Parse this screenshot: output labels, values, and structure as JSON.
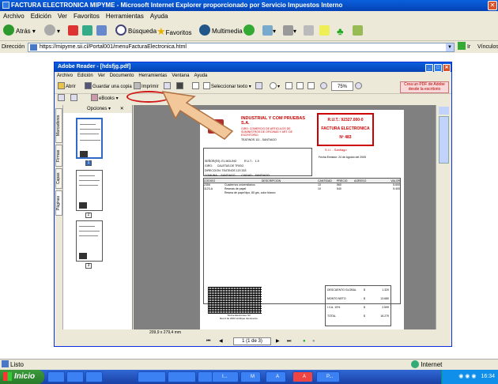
{
  "ie": {
    "title": "FACTURA ELECTRONICA MIPYME - Microsoft Internet Explorer proporcionado por Servicio Impuestos Interno",
    "menu": [
      "Archivo",
      "Edición",
      "Ver",
      "Favoritos",
      "Herramientas",
      "Ayuda"
    ],
    "toolbar": {
      "back": "Atrás",
      "search": "Búsqueda",
      "favorites": "Favoritos",
      "multimedia": "Multimedia"
    },
    "address_label": "Dirección",
    "address": "https://mipyme.sii.cl/Portal001/menuFacturaElectronica.html",
    "go": "Ir",
    "links": "Vínculos",
    "status": "Listo",
    "zone": "Internet"
  },
  "reader": {
    "title": "Adobe Reader - [hdsfjg.pdf]",
    "menu": [
      "Archivo",
      "Edición",
      "Ver",
      "Documento",
      "Herramientas",
      "Ventana",
      "Ayuda"
    ],
    "open": "Abrir",
    "save": "Guardar una copia",
    "print": "Imprimir",
    "select_text": "Seleccionar texto",
    "zoom": "75%",
    "ebooks": "eBooks",
    "pdf_banner": "Crea un PDF de Adobe desde la escritorio",
    "panel_title": "Opciones",
    "side_tabs": [
      "Marcadores",
      "Firmas",
      "Capas",
      "Páginas"
    ],
    "thumb_pages": [
      "1",
      "2",
      "3"
    ],
    "size": "209,9 x 279,4 mm",
    "page_field": "1 (1 de 3)"
  },
  "invoice": {
    "company": "INDUSTRIAL Y COM PRUEBAS S.A.",
    "activity": "GIRO: COMERCIO DE ARTICULOS DE SUMINISTROS DE OFICINAS Y ART. DE ESCRITORIO",
    "address": "TEATINOS 111 - SANTIAGO",
    "rut": "R.U.T.: 92327.000-0",
    "doc_type": "FACTURA ELECTRONICA",
    "number": "Nº 483",
    "sii": "S.I.I. - Santiago",
    "date": "Fecha Emisión: 24 de Agosto del 2005",
    "client": [
      "SEÑOR(ES): EL MOLINO          R.U.T.:   1-9",
      "GIRO:      CALETAS DE TRIGO",
      "DIRECCION: TEATINOS 120 333",
      "COMUNA:    SANTIAGO        CIUDAD:   SANTIAGO",
      "CONTACTO:  Juan Cerro"
    ],
    "headers": [
      "CODIGO",
      "DESCRIPCION",
      "CANTIDAD",
      "PRECIO",
      "AGREGO",
      "VALOR"
    ],
    "rows": [
      [
        "2356",
        "Cuadernos universitarios",
        "10",
        "560",
        "",
        "5.600"
      ],
      [
        "1123-A",
        "Resmas de papel",
        "10",
        "540",
        "",
        "5.400"
      ],
      [
        "",
        "Resma de papel tipo, 80 grs, color blanco",
        "",
        "",
        "",
        ""
      ]
    ],
    "totals": [
      [
        "DESCUENTO GLOBAL",
        "$",
        "1.320"
      ],
      [
        "MONTO NETO",
        "$",
        "13.680"
      ],
      [
        "I.V.A. 19%",
        "$",
        "2.599"
      ],
      [
        "TOTAL",
        "$",
        "16.279"
      ]
    ],
    "stamp_caption": "Timbre Electrónico SII\nRes.0 de 2003 Verifique documento"
  },
  "taskbar": {
    "start": "Inicio",
    "buttons": [
      "",
      "I...",
      "M",
      "",
      "A",
      "",
      "A",
      "P..."
    ],
    "clock": "16:34"
  }
}
